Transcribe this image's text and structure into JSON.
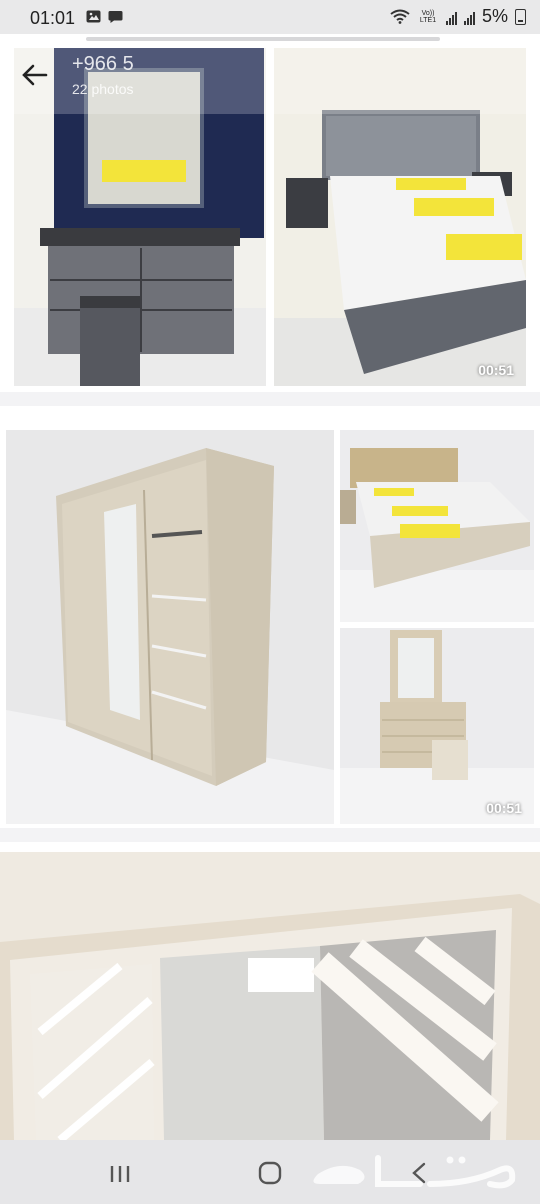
{
  "status_bar": {
    "time": "01:01",
    "network_label": "Vo)) LTE1",
    "battery": "5%"
  },
  "header": {
    "title": "+966 5",
    "subtitle": "22 photos"
  },
  "gallery": [
    {
      "name": "dresser-photo",
      "label": ""
    },
    {
      "name": "bed-photo",
      "duration": "00:51"
    },
    {
      "name": "wardrobe-photo"
    },
    {
      "name": "beige-bed-photo"
    },
    {
      "name": "beige-dresser-photo",
      "duration": "00:51"
    },
    {
      "name": "wardrobe-closeup-photo"
    }
  ],
  "watermark": {
    "brand": "حراج"
  },
  "icons": {
    "back": "back-arrow-icon",
    "recents": "recents-icon",
    "home": "home-icon",
    "navback": "nav-back-icon"
  },
  "colors": {
    "status_bg": "#e9e9ea",
    "nav_bg": "#e6e6e8",
    "divider": "#f3f3f5"
  }
}
